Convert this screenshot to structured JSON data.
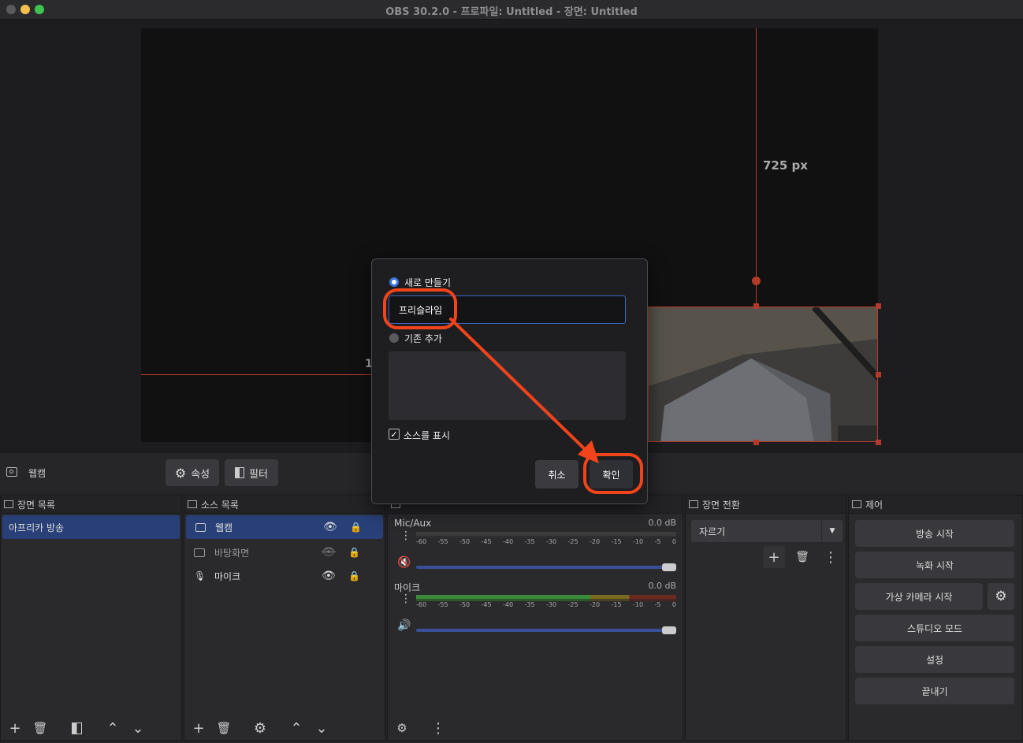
{
  "window": {
    "title": "OBS 30.2.0 - 프로파일: Untitled - 장면: Untitled"
  },
  "preview": {
    "dimension_label": "725 px",
    "partial_label": "1"
  },
  "source_toolbar": {
    "source_name": "웹캠",
    "properties_label": "속성",
    "filters_label": "필터"
  },
  "scenes": {
    "header": "장면 목록",
    "items": [
      "아프리카 방송"
    ]
  },
  "sources": {
    "header": "소스 목록",
    "items": [
      {
        "label": "웹캠",
        "icon": "camera-icon",
        "visible": true
      },
      {
        "label": "바탕화면",
        "icon": "monitor-icon",
        "visible": false
      },
      {
        "label": "마이크",
        "icon": "microphone-icon",
        "visible": true
      }
    ]
  },
  "mixer": {
    "channels": [
      {
        "name": "Mic/Aux",
        "db": "0.0 dB",
        "muted": true
      },
      {
        "name": "마이크",
        "db": "0.0 dB",
        "muted": false
      }
    ],
    "ticks": [
      "-60",
      "-55",
      "-50",
      "-45",
      "-40",
      "-35",
      "-30",
      "-25",
      "-20",
      "-15",
      "-10",
      "-5",
      "0"
    ]
  },
  "transitions": {
    "header": "장면 전환",
    "selected": "자르기"
  },
  "controls": {
    "header": "제어",
    "start_streaming": "방송 시작",
    "start_recording": "녹화 시작",
    "start_virtual_camera": "가상 카메라 시작",
    "studio_mode": "스튜디오 모드",
    "settings": "설정",
    "exit": "끝내기"
  },
  "dialog": {
    "create_new_label": "새로 만들기",
    "name_value": "프리슬라임",
    "add_existing_label": "기존 추가",
    "show_source_label": "소스를 표시",
    "show_source_checked": true,
    "cancel_label": "취소",
    "ok_label": "확인"
  },
  "colors": {
    "accent": "#284077",
    "annotation": "#f2441b",
    "selection_red": "#b33a2a"
  }
}
